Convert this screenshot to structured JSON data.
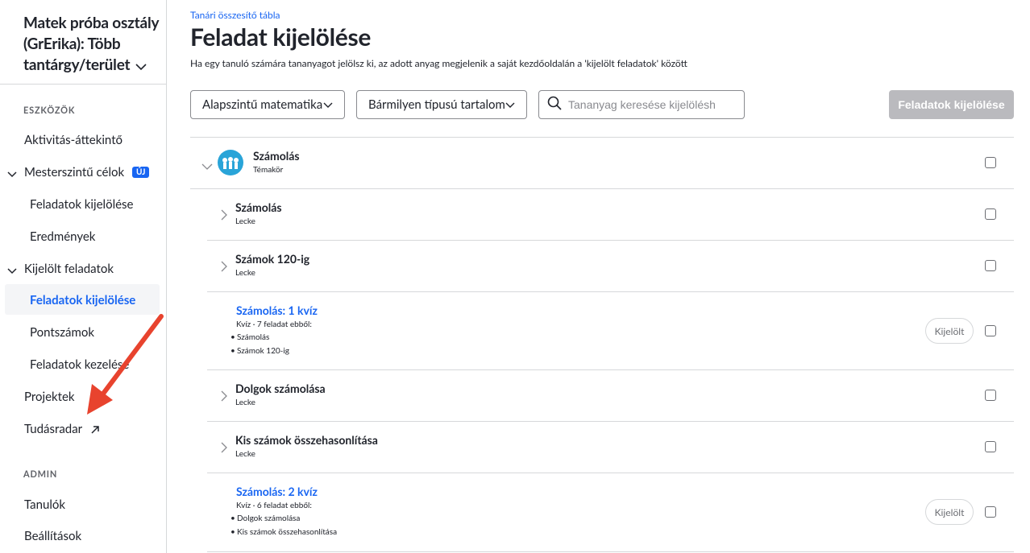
{
  "sidebar": {
    "class_title": "Matek próba osztály (GrErika): Több tantárgy/terület",
    "sections": {
      "tools": "ESZKÖZÖK",
      "admin": "ADMIN"
    },
    "items": {
      "activity": "Aktivitás-áttekintő",
      "mastery": "Mesterszintű célok",
      "mastery_badge": "ÚJ",
      "mastery_assign": "Feladatok kijelölése",
      "mastery_results": "Eredmények",
      "assigned": "Kijelölt feladatok",
      "assigned_assign": "Feladatok kijelölése",
      "assigned_scores": "Pontszámok",
      "assigned_manage": "Feladatok kezelése",
      "projects": "Projektek",
      "radar": "Tudásradar",
      "students": "Tanulók",
      "settings": "Beállítások"
    }
  },
  "main": {
    "breadcrumb": "Tanári összesítő tábla",
    "title": "Feladat kijelölése",
    "description": "Ha egy tanuló számára tananyagot jelölsz ki, az adott anyag megjelenik a saját kezdőoldalán a 'kijelölt feladatok' között",
    "filters": {
      "course": "Alapszintű matematika",
      "content_type": "Bármilyen típusú tartalom",
      "search_placeholder": "Tananyag keresése kijelölésh"
    },
    "assign_button": "Feladatok kijelölése",
    "topic": {
      "title": "Számolás",
      "subtitle": "Témakör"
    },
    "rows": [
      {
        "title": "Számolás",
        "subtitle": "Lecke"
      },
      {
        "title": "Számok 120-ig",
        "subtitle": "Lecke"
      },
      {
        "title": "Számolás: 1 kvíz",
        "subtitle": "Kvíz · 7 feladat ebből:",
        "bullets": [
          "Számolás",
          "Számok 120-ig"
        ],
        "pill": "Kijelölt"
      },
      {
        "title": "Dolgok számolása",
        "subtitle": "Lecke"
      },
      {
        "title": "Kis számok összehasonlítása",
        "subtitle": "Lecke"
      },
      {
        "title": "Számolás: 2 kvíz",
        "subtitle": "Kvíz · 6 feladat ebből:",
        "bullets": [
          "Dolgok számolása",
          "Kis számok összehasonlítása"
        ],
        "pill": "Kijelölt"
      }
    ]
  },
  "colors": {
    "accent": "#1865f2",
    "annotation_arrow": "#e8432e"
  }
}
